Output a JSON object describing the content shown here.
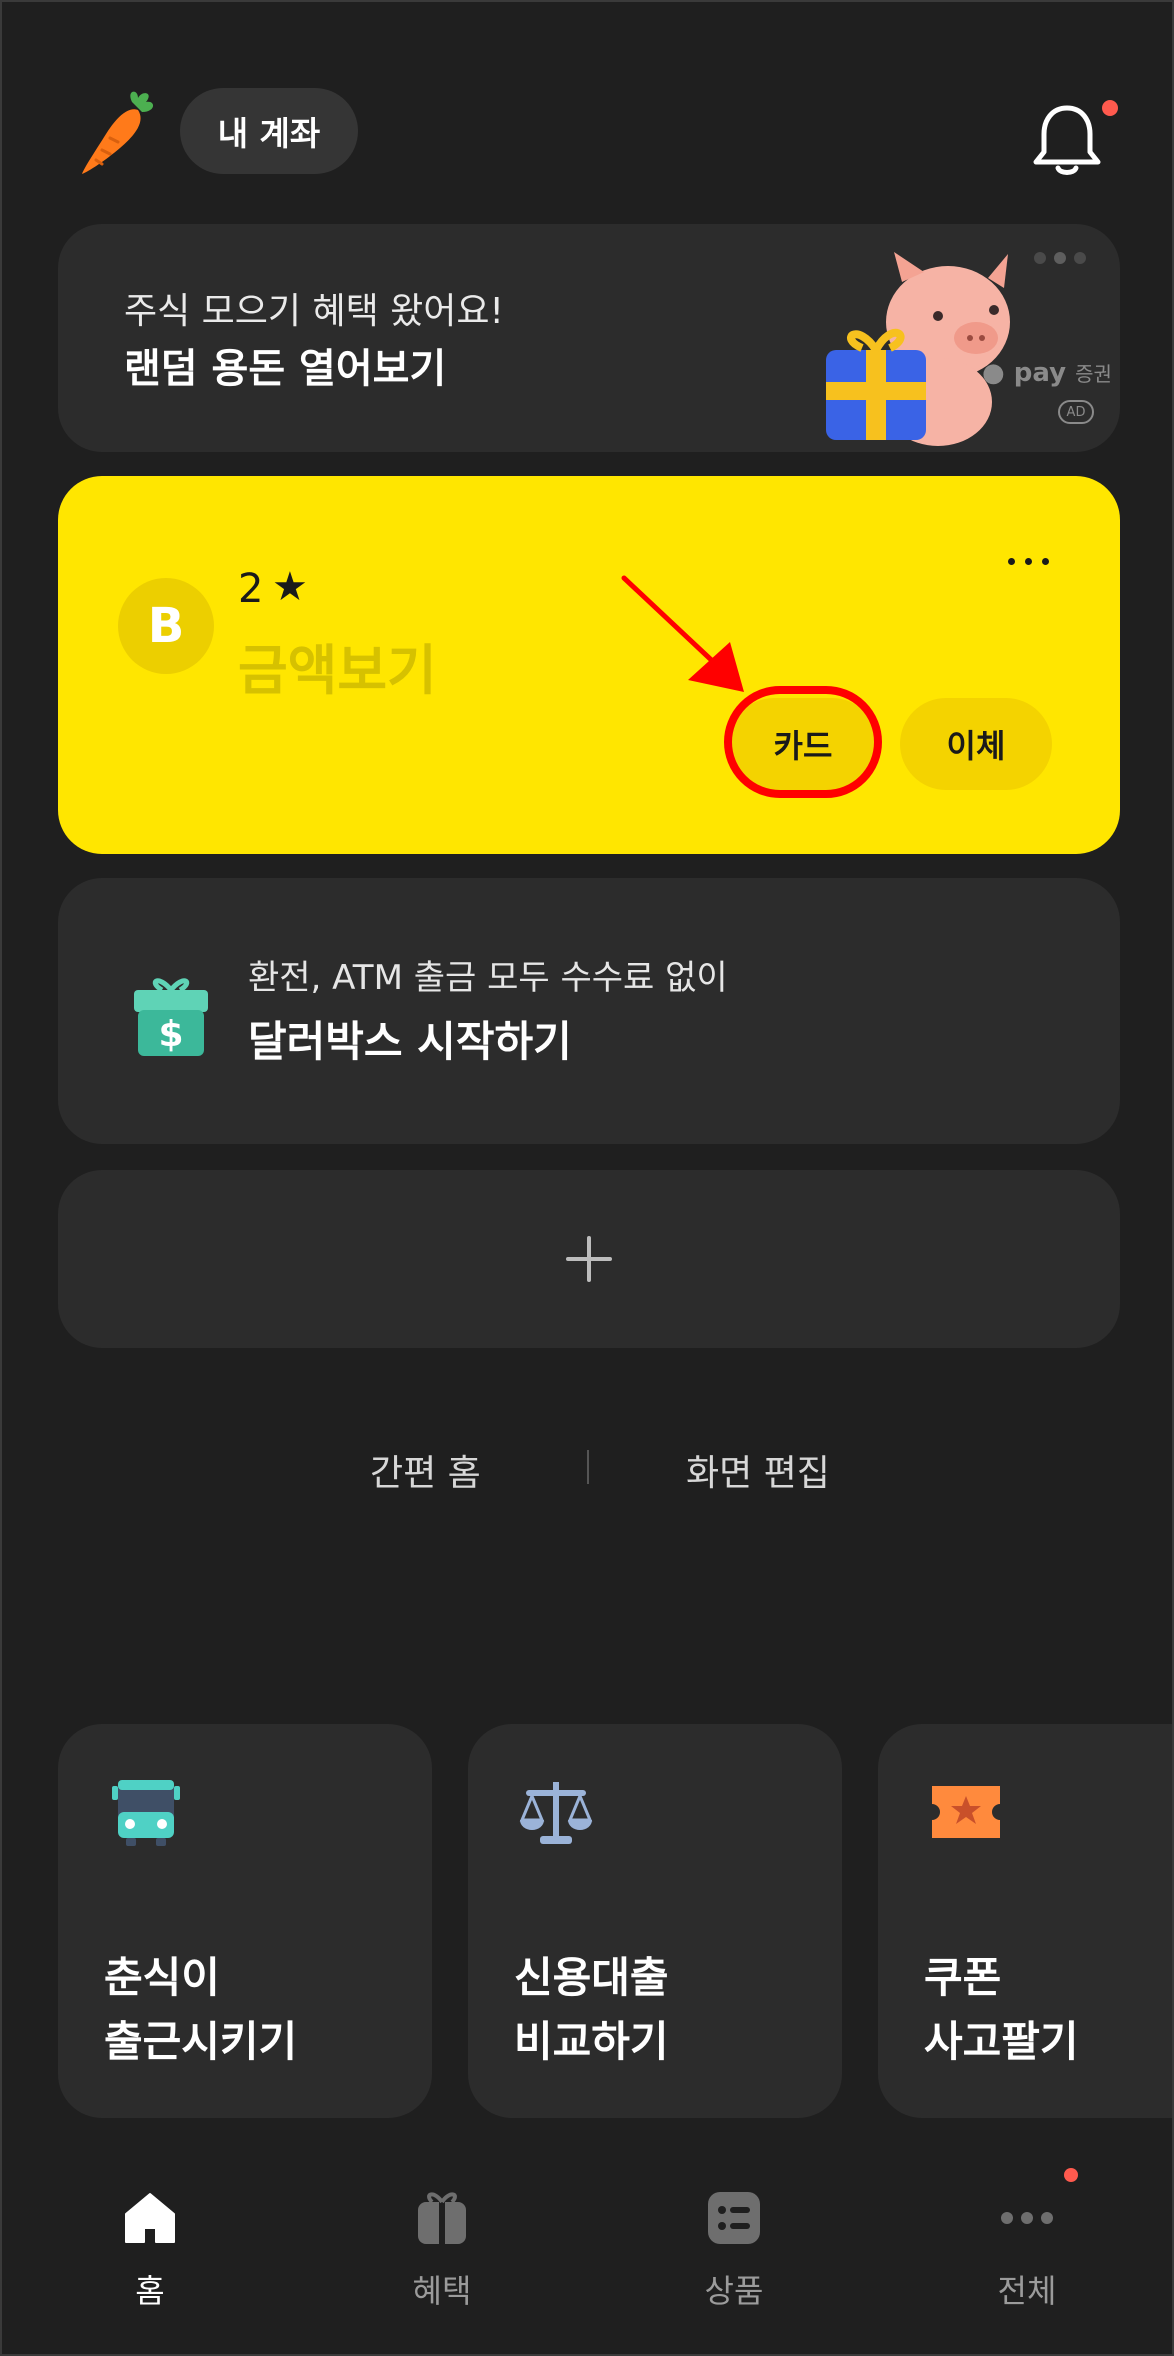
{
  "header": {
    "account_pill_label": "내 계좌",
    "notification_has_unread": true
  },
  "ad_banner": {
    "line1": "주식 모으기 혜택 왔어요!",
    "line2": "랜덤 용돈 열어보기",
    "brand": "pay",
    "brand_suffix": "증권",
    "badge": "AD"
  },
  "account_card": {
    "logo_letter": "B",
    "name": "2",
    "amount_placeholder": "금액보기",
    "card_button": "카드",
    "transfer_button": "이체",
    "accent_color": "#ffe600"
  },
  "dollar_box": {
    "subtitle": "환전, ATM 출금 모두 수수료 없이",
    "title": "달러박스 시작하기"
  },
  "links": {
    "simple_home": "간편 홈",
    "edit_screen": "화면 편집"
  },
  "features": [
    {
      "icon": "bus-icon",
      "line1": "춘식이",
      "line2": "출근시키기"
    },
    {
      "icon": "scale-icon",
      "line1": "신용대출",
      "line2": "비교하기"
    },
    {
      "icon": "ticket-icon",
      "line1": "쿠폰",
      "line2": "사고팔기"
    }
  ],
  "tabbar": {
    "items": [
      {
        "label": "홈",
        "icon": "home-icon",
        "active": true
      },
      {
        "label": "혜택",
        "icon": "gift-icon",
        "active": false
      },
      {
        "label": "상품",
        "icon": "list-icon",
        "active": false
      },
      {
        "label": "전체",
        "icon": "more-icon",
        "active": false
      }
    ]
  }
}
